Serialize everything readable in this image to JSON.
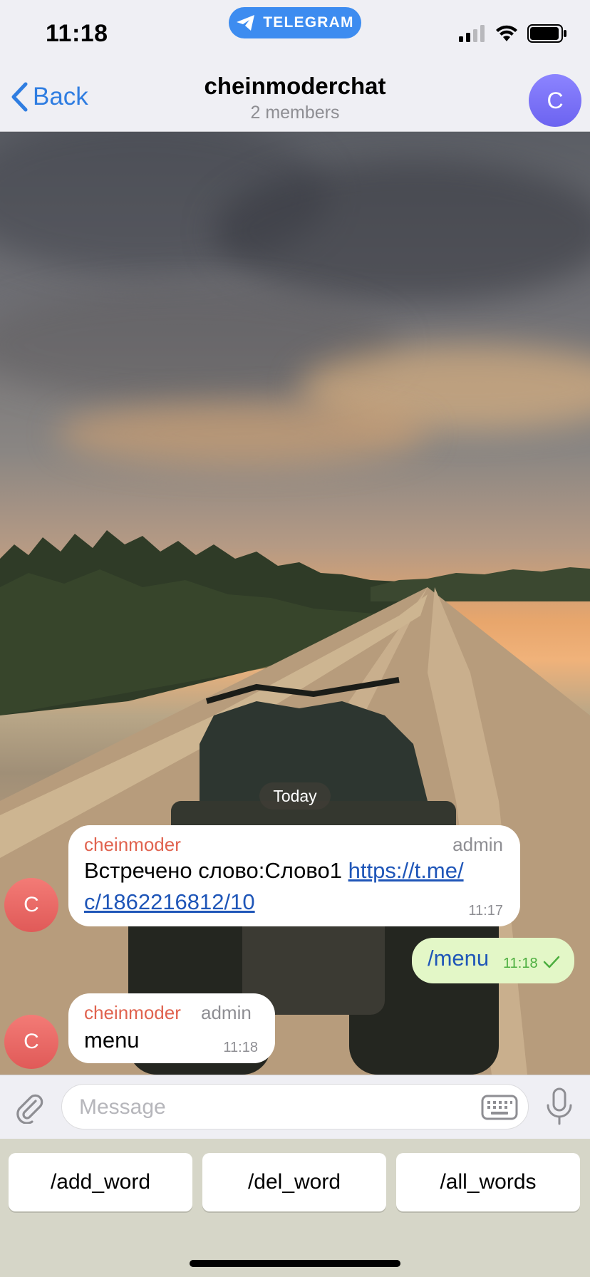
{
  "status_bar": {
    "time": "11:18",
    "app_pill": "TELEGRAM"
  },
  "nav": {
    "back_label": "Back",
    "title": "cheinmoderchat",
    "subtitle": "2 members",
    "avatar_letter": "C"
  },
  "date_badge": "Today",
  "messages": [
    {
      "author": "cheinmoder",
      "role": "admin",
      "text": "Встречено слово:Слово1 ",
      "link": "https://t.me/c/1862216812/10",
      "link_line1": "https://t.me/",
      "link_line2": "c/1862216812/10",
      "time": "11:17",
      "avatar_letter": "C"
    },
    {
      "outgoing": true,
      "text": "/menu",
      "time": "11:18"
    },
    {
      "author": "cheinmoder",
      "role": "admin",
      "text": "menu",
      "time": "11:18",
      "avatar_letter": "C"
    }
  ],
  "input": {
    "placeholder": "Message"
  },
  "keyboard": {
    "buttons": [
      "/add_word",
      "/del_word",
      "/all_words"
    ]
  },
  "colors": {
    "accent": "#2f7de1",
    "author": "#e0634f",
    "outgoing_bubble": "#e3f7c7",
    "check": "#4cae3f"
  }
}
